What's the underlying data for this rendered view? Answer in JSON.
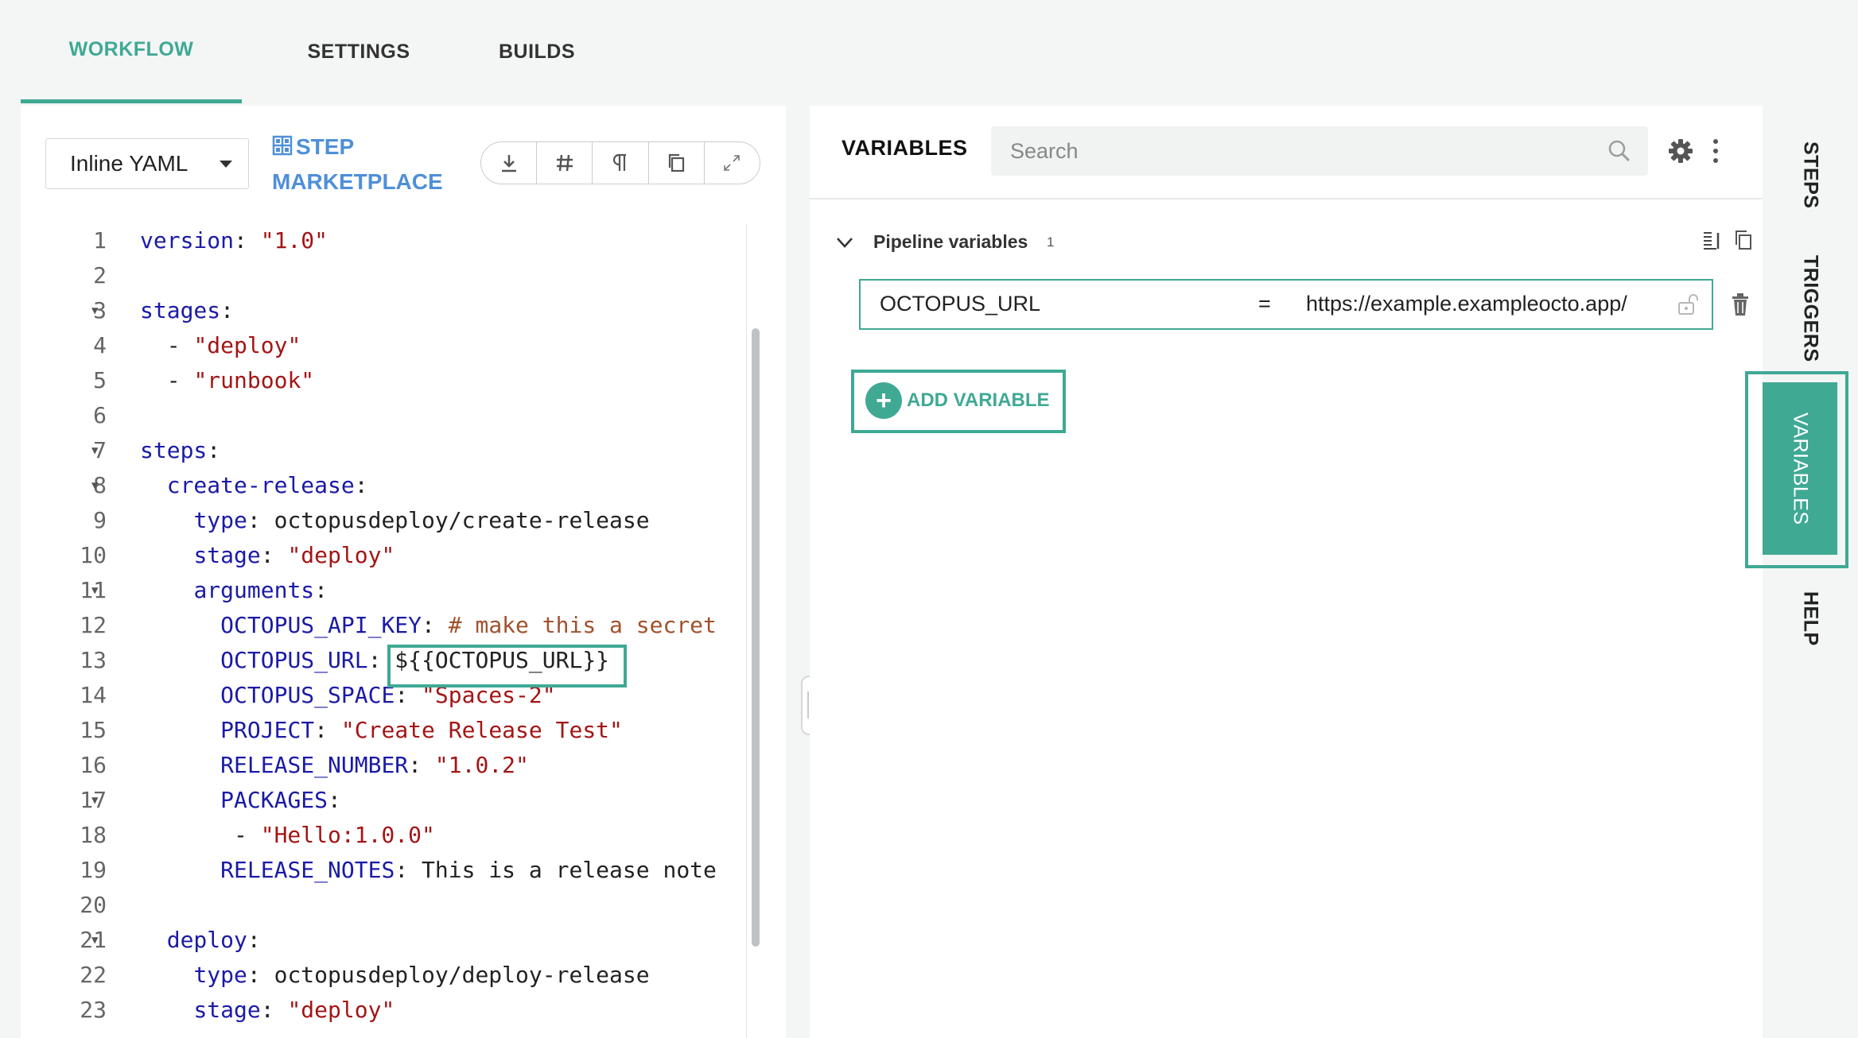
{
  "tabs": [
    {
      "label": "WORKFLOW",
      "active": true
    },
    {
      "label": "SETTINGS",
      "active": false
    },
    {
      "label": "BUILDS",
      "active": false
    }
  ],
  "editor": {
    "mode_label": "Inline YAML",
    "marketplace_line1": "STEP",
    "marketplace_line2": "MARKETPLACE",
    "toolbar_icons": [
      "download-icon",
      "hash-icon",
      "pilcrow-icon",
      "copy-icon",
      "expand-icon"
    ],
    "lines": [
      {
        "n": "1",
        "fold": false,
        "tokens": [
          [
            "k",
            "version"
          ],
          [
            "v",
            ": "
          ],
          [
            "s",
            "\"1.0\""
          ]
        ]
      },
      {
        "n": "2",
        "fold": false,
        "tokens": []
      },
      {
        "n": "3",
        "fold": true,
        "tokens": [
          [
            "k",
            "stages"
          ],
          [
            "v",
            ":"
          ]
        ]
      },
      {
        "n": "4",
        "fold": false,
        "tokens": [
          [
            "v",
            "  - "
          ],
          [
            "s",
            "\"deploy\""
          ]
        ]
      },
      {
        "n": "5",
        "fold": false,
        "tokens": [
          [
            "v",
            "  - "
          ],
          [
            "s",
            "\"runbook\""
          ]
        ]
      },
      {
        "n": "6",
        "fold": false,
        "tokens": []
      },
      {
        "n": "7",
        "fold": true,
        "tokens": [
          [
            "k",
            "steps"
          ],
          [
            "v",
            ":"
          ]
        ]
      },
      {
        "n": "8",
        "fold": true,
        "tokens": [
          [
            "v",
            "  "
          ],
          [
            "k",
            "create-release"
          ],
          [
            "v",
            ":"
          ]
        ]
      },
      {
        "n": "9",
        "fold": false,
        "tokens": [
          [
            "v",
            "    "
          ],
          [
            "k",
            "type"
          ],
          [
            "v",
            ": octopusdeploy/create-release"
          ]
        ]
      },
      {
        "n": "10",
        "fold": false,
        "tokens": [
          [
            "v",
            "    "
          ],
          [
            "k",
            "stage"
          ],
          [
            "v",
            ": "
          ],
          [
            "s",
            "\"deploy\""
          ]
        ]
      },
      {
        "n": "11",
        "fold": true,
        "tokens": [
          [
            "v",
            "    "
          ],
          [
            "k",
            "arguments"
          ],
          [
            "v",
            ":"
          ]
        ]
      },
      {
        "n": "12",
        "fold": false,
        "tokens": [
          [
            "v",
            "      "
          ],
          [
            "k",
            "OCTOPUS_API_KEY"
          ],
          [
            "v",
            ": "
          ],
          [
            "c",
            "# make this a secret"
          ]
        ]
      },
      {
        "n": "13",
        "fold": false,
        "tokens": [
          [
            "v",
            "      "
          ],
          [
            "k",
            "OCTOPUS_URL"
          ],
          [
            "v",
            ": ${{OCTOPUS_URL}}"
          ]
        ]
      },
      {
        "n": "14",
        "fold": false,
        "tokens": [
          [
            "v",
            "      "
          ],
          [
            "k",
            "OCTOPUS_SPACE"
          ],
          [
            "v",
            ": "
          ],
          [
            "s",
            "\"Spaces-2\""
          ]
        ]
      },
      {
        "n": "15",
        "fold": false,
        "tokens": [
          [
            "v",
            "      "
          ],
          [
            "k",
            "PROJECT"
          ],
          [
            "v",
            ": "
          ],
          [
            "s",
            "\"Create Release Test\""
          ]
        ]
      },
      {
        "n": "16",
        "fold": false,
        "tokens": [
          [
            "v",
            "      "
          ],
          [
            "k",
            "RELEASE_NUMBER"
          ],
          [
            "v",
            ": "
          ],
          [
            "s",
            "\"1.0.2\""
          ]
        ]
      },
      {
        "n": "17",
        "fold": true,
        "tokens": [
          [
            "v",
            "      "
          ],
          [
            "k",
            "PACKAGES"
          ],
          [
            "v",
            ":"
          ]
        ]
      },
      {
        "n": "18",
        "fold": false,
        "tokens": [
          [
            "v",
            "       - "
          ],
          [
            "s",
            "\"Hello:1.0.0\""
          ]
        ]
      },
      {
        "n": "19",
        "fold": false,
        "tokens": [
          [
            "v",
            "      "
          ],
          [
            "k",
            "RELEASE_NOTES"
          ],
          [
            "v",
            ": This is a release note"
          ]
        ]
      },
      {
        "n": "20",
        "fold": false,
        "tokens": []
      },
      {
        "n": "21",
        "fold": true,
        "tokens": [
          [
            "v",
            "  "
          ],
          [
            "k",
            "deploy"
          ],
          [
            "v",
            ":"
          ]
        ]
      },
      {
        "n": "22",
        "fold": false,
        "tokens": [
          [
            "v",
            "    "
          ],
          [
            "k",
            "type"
          ],
          [
            "v",
            ": octopusdeploy/deploy-release"
          ]
        ]
      },
      {
        "n": "23",
        "fold": false,
        "tokens": [
          [
            "v",
            "    "
          ],
          [
            "k",
            "stage"
          ],
          [
            "v",
            ": "
          ],
          [
            "s",
            "\"deploy\""
          ]
        ]
      }
    ]
  },
  "variables": {
    "title": "VARIABLES",
    "search_placeholder": "Search",
    "section_label": "Pipeline variables",
    "section_count": "1",
    "items": [
      {
        "name": "OCTOPUS_URL",
        "eq": "=",
        "value": "https://example.exampleocto.app/"
      }
    ],
    "add_label": "ADD VARIABLE"
  },
  "side_tabs": {
    "steps": "STEPS",
    "triggers": "TRIGGERS",
    "variables": "VARIABLES",
    "help": "HELP"
  },
  "colors": {
    "accent": "#3fa994",
    "link": "#4f8fd8",
    "keyword": "#1a1aa6",
    "string": "#a31515",
    "comment": "#a0522d"
  }
}
